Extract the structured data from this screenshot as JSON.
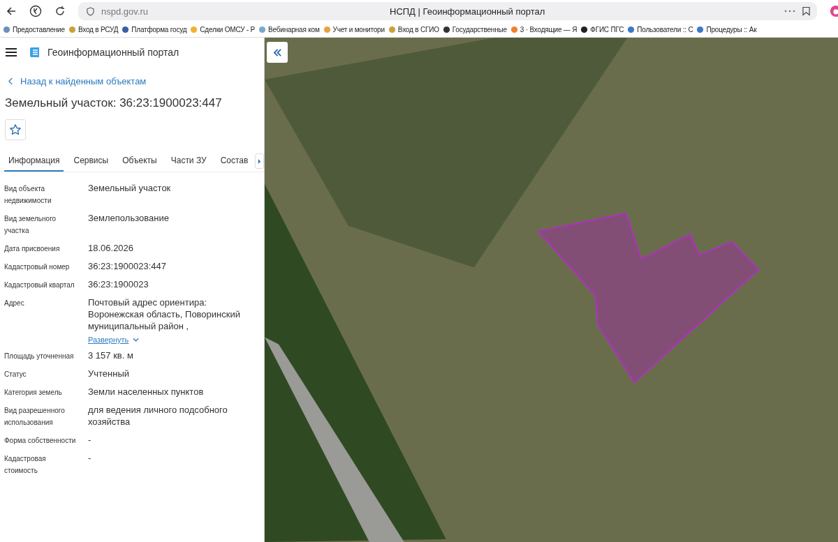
{
  "browser": {
    "url": "nspd.gov.ru",
    "title": "НСПД | Геоинформационный портал"
  },
  "bookmarks": [
    {
      "label": "Предоставление"
    },
    {
      "label": "Вход в РСУД"
    },
    {
      "label": "Платформа госуд"
    },
    {
      "label": "Сделки ОМСУ - Р"
    },
    {
      "label": "Вебинарная ком"
    },
    {
      "label": "Учет и монитори"
    },
    {
      "label": "Вход в СГИО"
    },
    {
      "label": "Государственные"
    },
    {
      "label": "3 · Входящие — Я"
    },
    {
      "label": "ФГИС ПГС"
    },
    {
      "label": "Пользователи :: С"
    },
    {
      "label": "Процедуры :: Ак"
    }
  ],
  "app_title": "Геоинформационный портал",
  "back_link": "Назад к найденным объектам",
  "heading": "Земельный участок: 36:23:1900023:447",
  "tabs": [
    {
      "label": "Информация",
      "selected": true
    },
    {
      "label": "Сервисы",
      "selected": false
    },
    {
      "label": "Объекты",
      "selected": false
    },
    {
      "label": "Части ЗУ",
      "selected": false
    },
    {
      "label": "Состав",
      "selected": false
    }
  ],
  "properties": [
    {
      "label": "Вид объекта недвижимости",
      "value": "Земельный участок"
    },
    {
      "label": "Вид земельного участка",
      "value": "Землепользование"
    },
    {
      "label": "Дата присвоения",
      "value": "18.06.2026"
    },
    {
      "label": "Кадастровый номер",
      "value": "36:23:1900023:447"
    },
    {
      "label": "Кадастровый квартал",
      "value": "36:23:1900023"
    },
    {
      "label": "Адрес",
      "value": "Почтовый адрес ориентира: Воронежская область, Поворинский муниципальный район ,",
      "expand_link": "Развернуть"
    },
    {
      "label": "Площадь уточненная",
      "value": "3 157 кв. м"
    },
    {
      "label": "Статус",
      "value": "Учтенный"
    },
    {
      "label": "Категория земель",
      "value": "Земли населенных пунктов"
    },
    {
      "label": "Вид разрешенного использования",
      "value": "для ведения личного подсобного хозяйства"
    },
    {
      "label": "Форма собственности",
      "value": "-"
    },
    {
      "label": "Кадастровая стоимость",
      "value": "-"
    }
  ]
}
